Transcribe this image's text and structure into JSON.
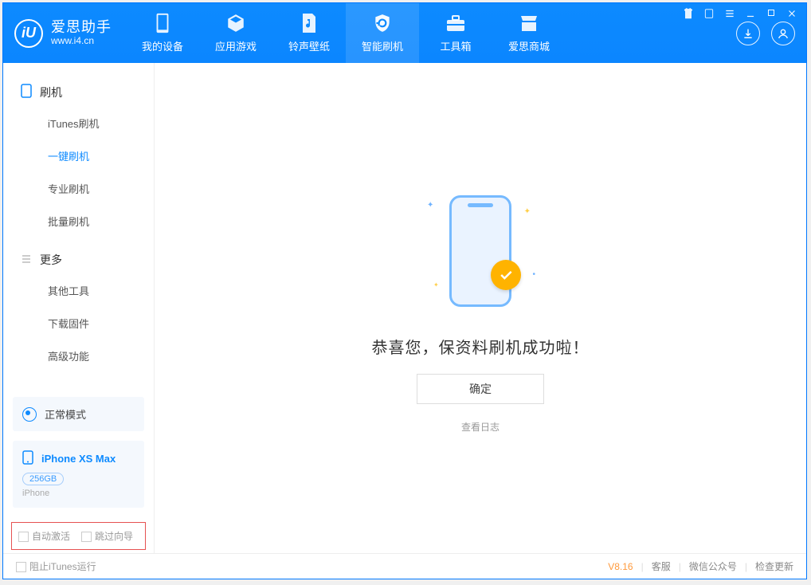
{
  "app": {
    "name": "爱思助手",
    "url": "www.i4.cn"
  },
  "tabs": [
    {
      "label": "我的设备"
    },
    {
      "label": "应用游戏"
    },
    {
      "label": "铃声壁纸"
    },
    {
      "label": "智能刷机"
    },
    {
      "label": "工具箱"
    },
    {
      "label": "爱思商城"
    }
  ],
  "sidebar": {
    "group1_title": "刷机",
    "group1_items": [
      {
        "label": "iTunes刷机"
      },
      {
        "label": "一键刷机"
      },
      {
        "label": "专业刷机"
      },
      {
        "label": "批量刷机"
      }
    ],
    "group2_title": "更多",
    "group2_items": [
      {
        "label": "其他工具"
      },
      {
        "label": "下载固件"
      },
      {
        "label": "高级功能"
      }
    ],
    "mode_label": "正常模式",
    "device": {
      "name": "iPhone XS Max",
      "storage": "256GB",
      "type": "iPhone"
    },
    "options": {
      "auto_activate": "自动激活",
      "skip_guide": "跳过向导"
    }
  },
  "main": {
    "success_text": "恭喜您，保资料刷机成功啦！",
    "confirm_label": "确定",
    "view_log_label": "查看日志"
  },
  "statusbar": {
    "block_itunes": "阻止iTunes运行",
    "version": "V8.16",
    "support": "客服",
    "wechat": "微信公众号",
    "update": "检查更新"
  }
}
